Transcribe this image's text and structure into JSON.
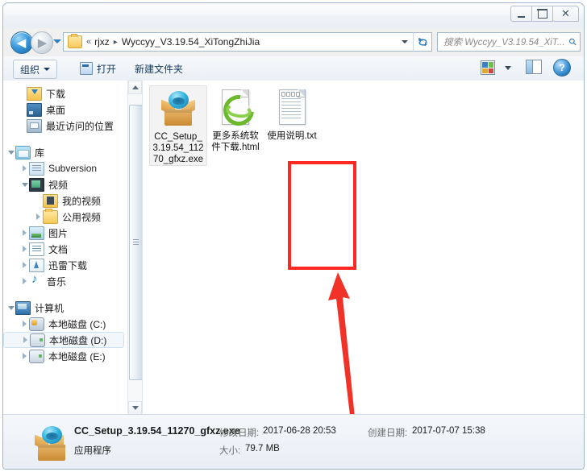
{
  "window": {
    "controls": {
      "minimize": "—",
      "maximize": "▢",
      "close": "✕"
    }
  },
  "address_bar": {
    "back_icon": "back-arrow",
    "forward_icon": "forward-arrow",
    "history_dropdown_icon": "chevron-down",
    "folder_icon": "folder-icon",
    "overflow": "«",
    "separator": "▸",
    "crumbs": [
      "rjxz",
      "Wyccyy_V3.19.54_XiTongZhiJia"
    ],
    "path_dropdown_icon": "chevron-down",
    "refresh_icon": "refresh-icon",
    "search": {
      "placeholder": "搜索 Wyccyy_V3.19.54_XiT...",
      "value": "",
      "icon": "search-icon"
    }
  },
  "toolbar": {
    "organize_label": "组织",
    "open_label": "打开",
    "new_folder_label": "新建文件夹",
    "view_icon": "view-layout-icon",
    "view_dropdown_icon": "chevron-down-icon",
    "preview_pane_icon": "preview-pane-icon",
    "help_icon": "help-icon",
    "help_glyph": "?"
  },
  "sidebar": {
    "items": [
      {
        "label": "下载",
        "icon": "download-folder-icon",
        "indent": "ind0",
        "expander": "none",
        "selected": false
      },
      {
        "label": "桌面",
        "icon": "desktop-icon",
        "indent": "ind0",
        "expander": "none",
        "selected": false
      },
      {
        "label": "最近访问的位置",
        "icon": "recent-places-icon",
        "indent": "ind0",
        "expander": "none",
        "selected": false
      },
      {
        "label": "库",
        "icon": "library-icon",
        "indent": "ind1",
        "expander": "open",
        "selected": false
      },
      {
        "label": "Subversion",
        "icon": "subversion-icon",
        "indent": "ind2",
        "expander": "closed",
        "selected": false
      },
      {
        "label": "视频",
        "icon": "video-library-icon",
        "indent": "ind2",
        "expander": "open",
        "selected": false
      },
      {
        "label": "我的视频",
        "icon": "my-videos-folder-icon",
        "indent": "ind3",
        "expander": "none",
        "selected": false
      },
      {
        "label": "公用视频",
        "icon": "public-videos-folder-icon",
        "indent": "ind3",
        "expander": "closed",
        "selected": false
      },
      {
        "label": "图片",
        "icon": "pictures-library-icon",
        "indent": "ind2",
        "expander": "closed",
        "selected": false
      },
      {
        "label": "文档",
        "icon": "documents-library-icon",
        "indent": "ind2",
        "expander": "closed",
        "selected": false
      },
      {
        "label": "迅雷下载",
        "icon": "thunder-download-icon",
        "indent": "ind2",
        "expander": "closed",
        "selected": false
      },
      {
        "label": "音乐",
        "icon": "music-library-icon",
        "indent": "ind2",
        "expander": "closed",
        "selected": false
      },
      {
        "label": "计算机",
        "icon": "computer-icon",
        "indent": "ind1",
        "expander": "open",
        "selected": false
      },
      {
        "label": "本地磁盘 (C:)",
        "icon": "system-drive-icon",
        "indent": "ind2",
        "expander": "closed",
        "selected": false
      },
      {
        "label": "本地磁盘 (D:)",
        "icon": "drive-icon",
        "indent": "ind2",
        "expander": "closed",
        "selected": true
      },
      {
        "label": "本地磁盘 (E:)",
        "icon": "drive-icon",
        "indent": "ind2",
        "expander": "closed",
        "selected": false
      }
    ],
    "gap_after": [
      2,
      11
    ],
    "scrollbar": {
      "up_icon": "scroll-up-arrow",
      "down_icon": "scroll-down-arrow"
    }
  },
  "files": [
    {
      "name": "CC_Setup_3.19.54_11270_gfxz.exe",
      "icon": "setup-package-icon",
      "selected": true
    },
    {
      "name": "更多系统软件下载.html",
      "icon": "ie-html-icon",
      "selected": false
    },
    {
      "name": "使用说明.txt",
      "icon": "text-file-icon",
      "selected": false
    }
  ],
  "annotations": {
    "highlight_color": "#fc2a22",
    "arrow_color": "#f03228",
    "target": "CC_Setup_3.19.54_11270_gfxz.exe"
  },
  "status_bar": {
    "icon": "setup-package-icon",
    "file_name": "CC_Setup_3.19.54_11270_gfxz.exe",
    "modified_label": "修改日期:",
    "modified_value": "2017-06-28 20:53",
    "created_label": "创建日期:",
    "created_value": "2017-07-07 15:38",
    "file_type": "应用程序",
    "size_label": "大小:",
    "size_value": "79.7 MB"
  }
}
